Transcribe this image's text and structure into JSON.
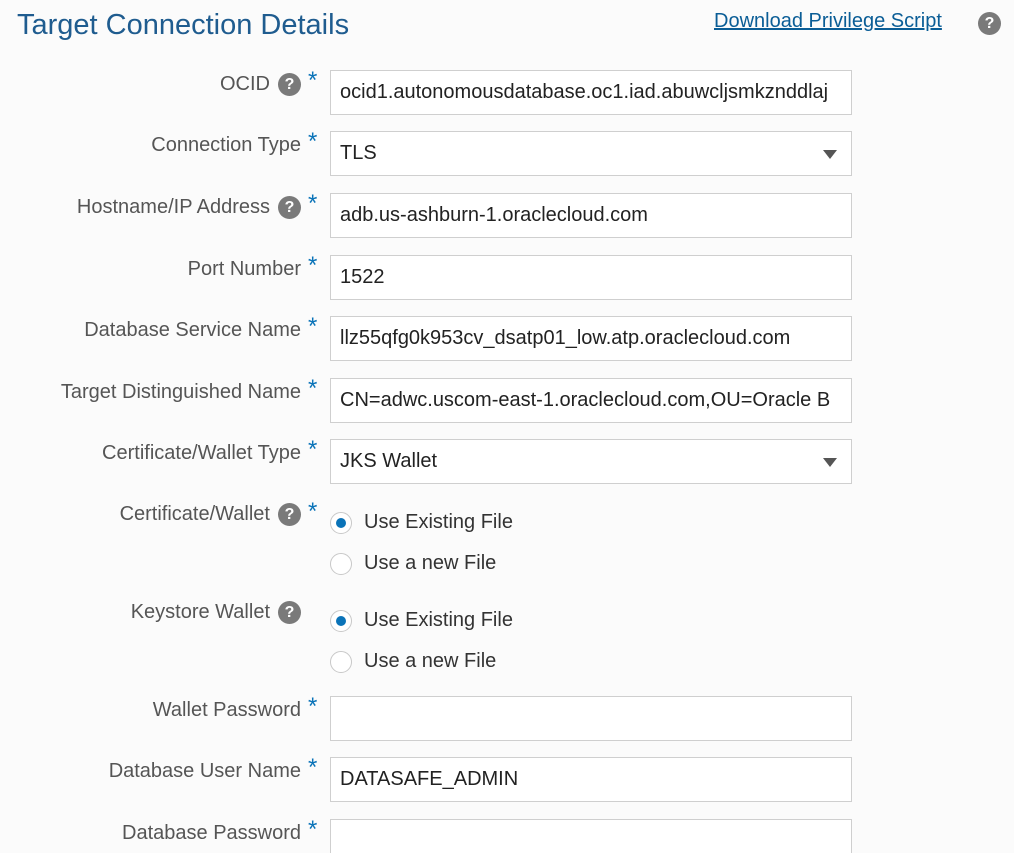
{
  "header": {
    "title": "Target Connection Details",
    "download_link": "Download Privilege Script",
    "help_symbol": "?"
  },
  "form": {
    "required_mark": "*",
    "ocid": {
      "label": "OCID",
      "value": "ocid1.autonomousdatabase.oc1.iad.abuwcljsmkznddlaj"
    },
    "connection_type": {
      "label": "Connection Type",
      "value": "TLS"
    },
    "hostname": {
      "label": "Hostname/IP Address",
      "value": "adb.us-ashburn-1.oraclecloud.com"
    },
    "port": {
      "label": "Port Number",
      "value": "1522"
    },
    "service_name": {
      "label": "Database Service Name",
      "value": "llz55qfg0k953cv_dsatp01_low.atp.oraclecloud.com"
    },
    "distinguished_name": {
      "label": "Target Distinguished Name",
      "value": "CN=adwc.uscom-east-1.oraclecloud.com,OU=Oracle B"
    },
    "wallet_type": {
      "label": "Certificate/Wallet Type",
      "value": "JKS Wallet"
    },
    "certificate_wallet": {
      "label": "Certificate/Wallet",
      "options": [
        "Use Existing File",
        "Use a new File"
      ],
      "selected": "Use Existing File"
    },
    "keystore_wallet": {
      "label": "Keystore Wallet",
      "options": [
        "Use Existing File",
        "Use a new File"
      ],
      "selected": "Use Existing File"
    },
    "wallet_password": {
      "label": "Wallet Password",
      "value": ""
    },
    "db_user": {
      "label": "Database User Name",
      "value": "DATASAFE_ADMIN"
    },
    "db_password": {
      "label": "Database Password",
      "value": ""
    }
  },
  "icons": {
    "help": "help-circle-icon",
    "dropdown": "chevron-down-icon"
  },
  "colors": {
    "title": "#1f5c8f",
    "link": "#0a5d96",
    "accent": "#0a73b8",
    "help_icon_bg": "#7a7a7a"
  }
}
